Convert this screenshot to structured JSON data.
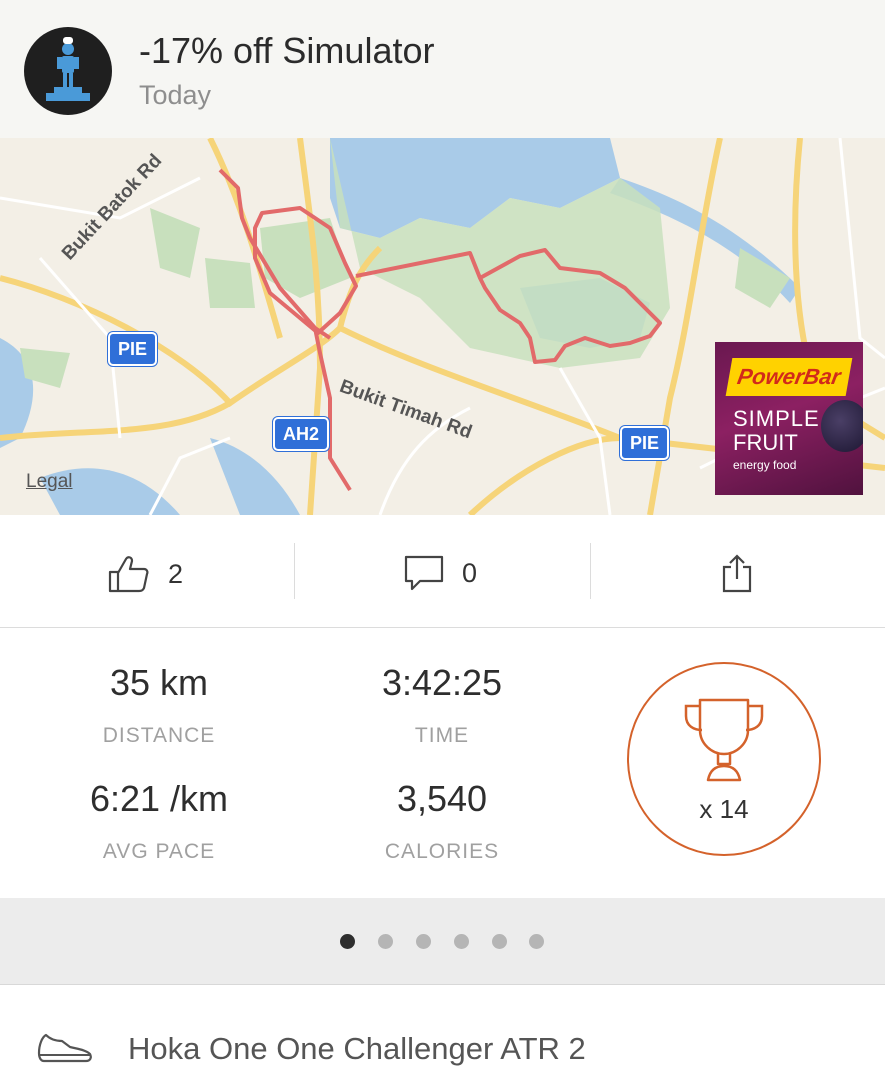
{
  "header": {
    "title": "-17% off Simulator",
    "date": "Today",
    "avatar_icon": "chef-podium-avatar"
  },
  "map": {
    "road_labels": [
      "Bukit Batok Rd",
      "Bukit Timah Rd"
    ],
    "shields": [
      "PIE",
      "AH2",
      "PIE"
    ],
    "legal": "Legal",
    "route_color": "#e26a6a"
  },
  "ad": {
    "brand": "PowerBar",
    "line1": "SIMPLE",
    "line2": "FRUIT",
    "line3": "energy food"
  },
  "actions": {
    "likes": "2",
    "comments": "0",
    "like_icon": "thumbs-up-icon",
    "comment_icon": "comment-icon",
    "share_icon": "share-icon"
  },
  "stats": {
    "distance_value": "35 km",
    "distance_label": "DISTANCE",
    "time_value": "3:42:25",
    "time_label": "TIME",
    "pace_value": "6:21 /km",
    "pace_label": "AVG PACE",
    "calories_value": "3,540",
    "calories_label": "CALORIES",
    "trophies": "x 14",
    "accent_color": "#d4622b"
  },
  "pager": {
    "total": 6,
    "active": 0
  },
  "gear": {
    "icon": "shoe-icon",
    "name": "Hoka One One Challenger ATR 2"
  }
}
